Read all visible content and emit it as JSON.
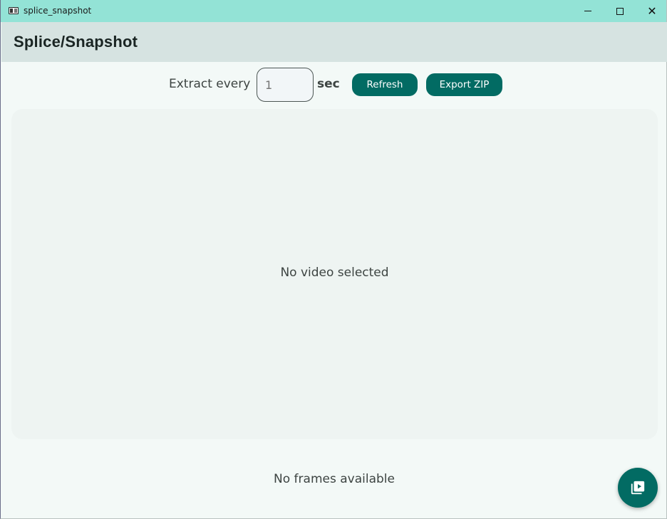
{
  "window": {
    "title": "splice_snapshot",
    "controls": [
      "minimize",
      "maximize",
      "close"
    ]
  },
  "appbar": {
    "title": "Splice/Snapshot"
  },
  "controls": {
    "extract_label": "Extract every",
    "interval_placeholder": "1",
    "interval_value": "",
    "unit_label": "sec",
    "refresh_label": "Refresh",
    "export_label": "Export ZIP"
  },
  "preview": {
    "empty_text": "No video selected"
  },
  "frames": {
    "empty_text": "No frames available"
  },
  "fab": {
    "icon": "video-library-icon"
  },
  "colors": {
    "titlebar": "#93e3d6",
    "appbar": "#d6e3e1",
    "primary": "#026b63",
    "background": "#f3f9f7",
    "panel": "#eef4f2"
  }
}
